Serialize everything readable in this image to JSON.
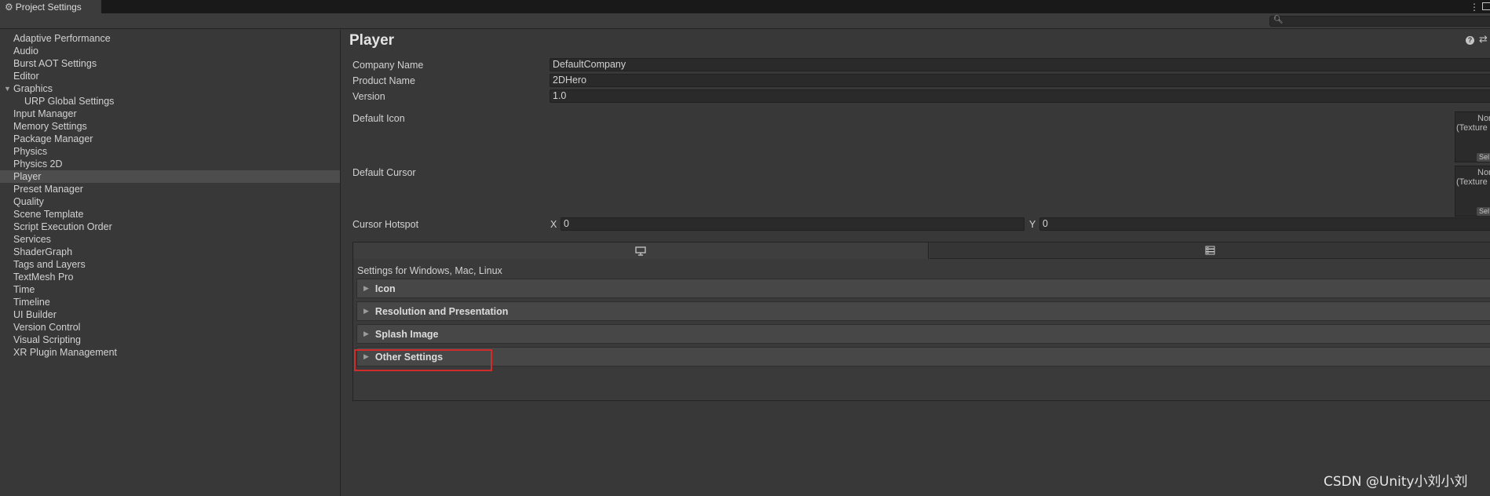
{
  "window": {
    "title": "Project Settings",
    "gear_icon": "gear-icon",
    "menu_icon": "⋮"
  },
  "search": {
    "value": "",
    "placeholder": ""
  },
  "sidebar": {
    "selected": "Player",
    "items": [
      {
        "label": "Adaptive Performance"
      },
      {
        "label": "Audio"
      },
      {
        "label": "Burst AOT Settings"
      },
      {
        "label": "Editor"
      },
      {
        "label": "Graphics",
        "expanded": true
      },
      {
        "label": "URP Global Settings",
        "child": true
      },
      {
        "label": "Input Manager"
      },
      {
        "label": "Memory Settings"
      },
      {
        "label": "Package Manager"
      },
      {
        "label": "Physics"
      },
      {
        "label": "Physics 2D"
      },
      {
        "label": "Player",
        "selected": true
      },
      {
        "label": "Preset Manager"
      },
      {
        "label": "Quality"
      },
      {
        "label": "Scene Template"
      },
      {
        "label": "Script Execution Order"
      },
      {
        "label": "Services"
      },
      {
        "label": "ShaderGraph"
      },
      {
        "label": "Tags and Layers"
      },
      {
        "label": "TextMesh Pro"
      },
      {
        "label": "Time"
      },
      {
        "label": "Timeline"
      },
      {
        "label": "UI Builder"
      },
      {
        "label": "Version Control"
      },
      {
        "label": "Visual Scripting"
      },
      {
        "label": "XR Plugin Management"
      }
    ]
  },
  "main": {
    "title": "Player",
    "company_label": "Company Name",
    "company_value": "DefaultCompany",
    "product_label": "Product Name",
    "product_value": "2DHero",
    "version_label": "Version",
    "version_value": "1.0",
    "default_icon_label": "Default Icon",
    "default_cursor_label": "Default Cursor",
    "texture_none": "None",
    "texture_type": "(Texture",
    "texture_select": "Sel",
    "hotspot_label": "Cursor Hotspot",
    "hotspot_x_label": "X",
    "hotspot_x_value": "0",
    "hotspot_y_label": "Y",
    "hotspot_y_value": "0",
    "platform_caption": "Settings for Windows, Mac, Linux",
    "sections": [
      {
        "label": "Icon"
      },
      {
        "label": "Resolution and Presentation"
      },
      {
        "label": "Splash Image"
      },
      {
        "label": "Other Settings",
        "highlighted": true
      }
    ]
  },
  "watermark": "CSDN @Unity小刘小刘",
  "colors": {
    "background": "#383838",
    "titlebar": "#191919",
    "selected_row": "#4d4d4d",
    "field_bg": "#2a2a2a",
    "highlight": "#d12c2c"
  }
}
